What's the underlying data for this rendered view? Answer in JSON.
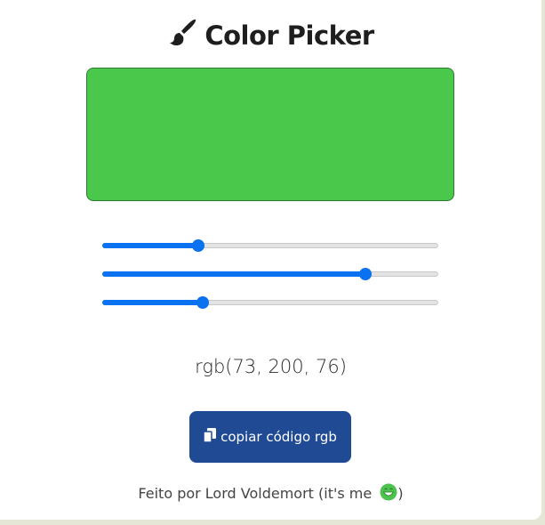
{
  "header": {
    "title": "Color Picker",
    "icon": "paintbrush-icon"
  },
  "preview": {
    "color": "#49c84c"
  },
  "sliders": [
    {
      "channel": "red",
      "value": 73,
      "max": 255
    },
    {
      "channel": "green",
      "value": 200,
      "max": 255
    },
    {
      "channel": "blue",
      "value": 76,
      "max": 255
    }
  ],
  "rgb_text": "rgb(73, 200, 76)",
  "copy_button": {
    "label": "copiar código rgb",
    "icon": "copy-icon",
    "color": "#214a95"
  },
  "footer": {
    "text": "Feito por Lord Voldemort (it's me ",
    "close": ")",
    "emoji_icon": "grinning-face-icon"
  },
  "accent": "#0a72f1"
}
